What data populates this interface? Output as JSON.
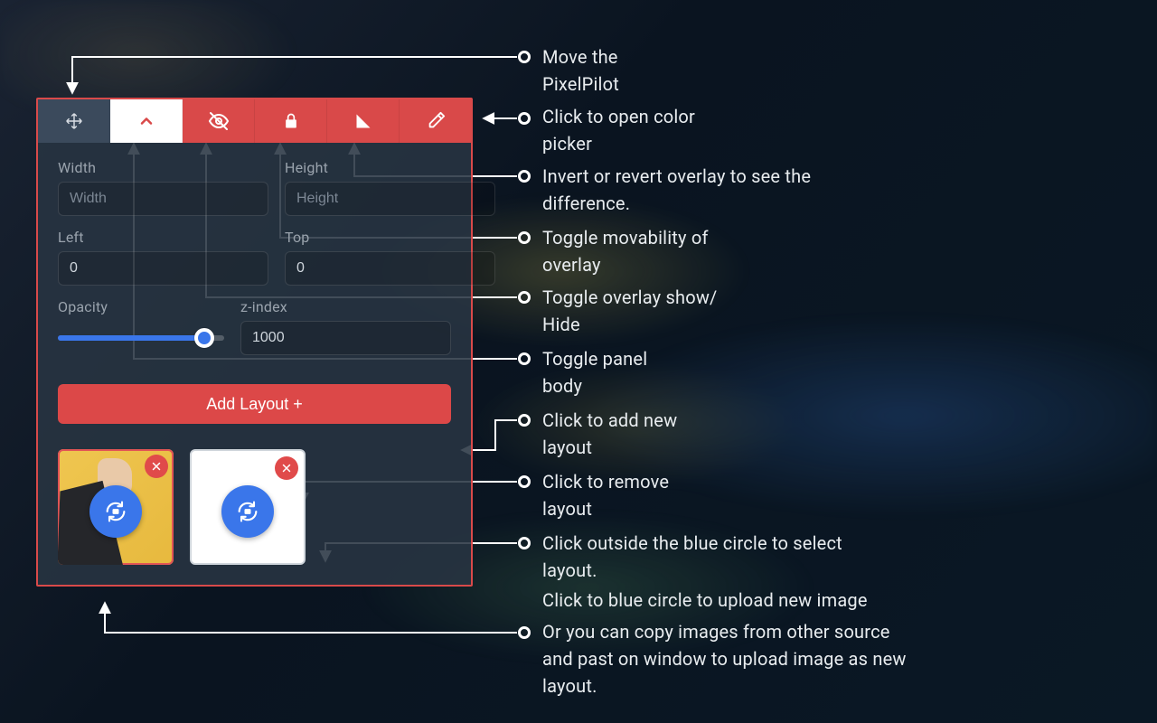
{
  "annotations": {
    "move": "Move the\nPixelPilot",
    "picker": "Click to open color\npicker",
    "invert": "Invert or revert overlay to see the\ndifference.",
    "lock": "Toggle movability of\noverlay",
    "visibility": "Toggle overlay show/\nHide",
    "collapse": "Toggle panel\nbody",
    "add": "Click to add new\nlayout",
    "remove": "Click to remove\nlayout",
    "select": "Click outside the blue circle to select\nlayout.",
    "upload": "Click to blue circle to upload new image",
    "paste": "Or you can copy images from other source\nand past on window to upload image as new\nlayout."
  },
  "panel": {
    "fields": {
      "width": {
        "label": "Width",
        "placeholder": "Width",
        "value": ""
      },
      "height": {
        "label": "Height",
        "placeholder": "Height",
        "value": ""
      },
      "left": {
        "label": "Left",
        "placeholder": "",
        "value": "0"
      },
      "top": {
        "label": "Top",
        "placeholder": "",
        "value": "0"
      },
      "opacity": {
        "label": "Opacity",
        "percent": 88
      },
      "zindex": {
        "label": "z-index",
        "placeholder": "",
        "value": "1000"
      }
    },
    "addLayout": "Add Layout +",
    "layouts": [
      {
        "selected": true,
        "bg": "image"
      },
      {
        "selected": false,
        "bg": "blank"
      }
    ]
  }
}
